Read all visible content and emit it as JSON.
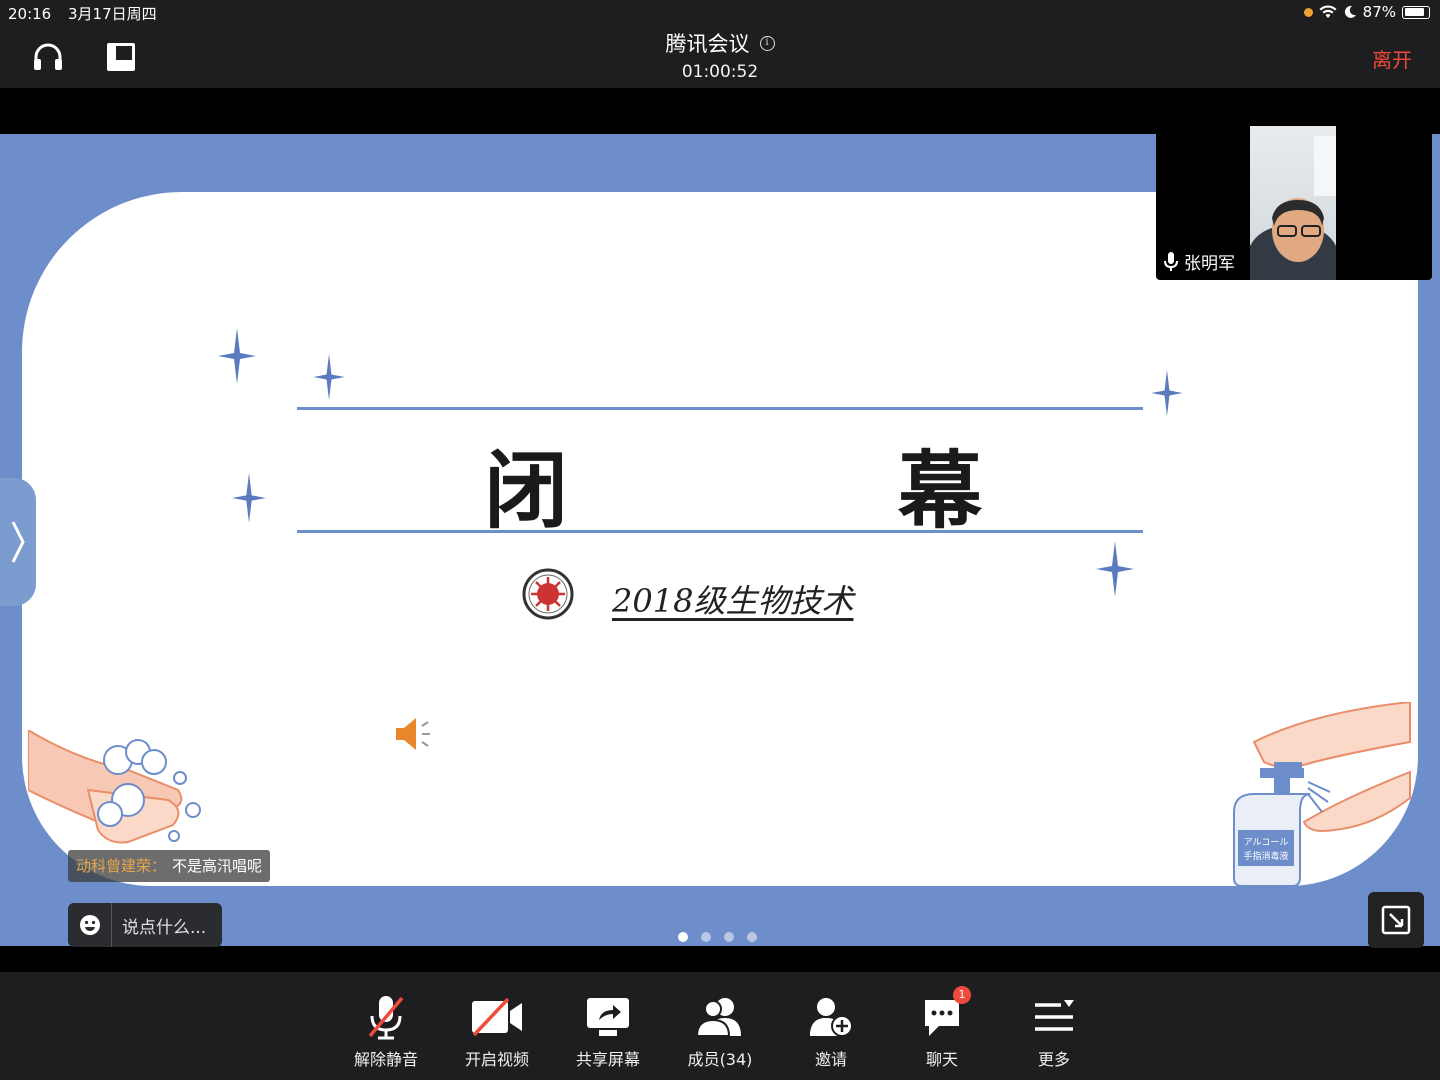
{
  "status_bar": {
    "time": "20:16",
    "date": "3月17日周四",
    "battery": "87%",
    "battery_level": 0.87
  },
  "header": {
    "title": "腾讯会议",
    "timer": "01:00:52",
    "leave_label": "离开"
  },
  "slide": {
    "char_left": "闭",
    "char_right": "幕",
    "subtitle": "2018级生物技术",
    "bottle_label_1": "アルコール",
    "bottle_label_2": "手指消毒液",
    "page_count": 4,
    "current_page": 1
  },
  "video": {
    "participant_name": "张明军"
  },
  "chat": {
    "author": "动科曾建荣：",
    "message": "不是高汛唱呢",
    "placeholder": "说点什么..."
  },
  "toolbar": {
    "unmute": "解除静音",
    "start_video": "开启视频",
    "share_screen": "共享屏幕",
    "members": "成员(34)",
    "invite": "邀请",
    "chat": "聊天",
    "chat_badge": "1",
    "more": "更多"
  },
  "colors": {
    "slide_blue": "#6e8ecb",
    "leave_red": "#f04a3c",
    "top_bar": "#1e1e20"
  }
}
